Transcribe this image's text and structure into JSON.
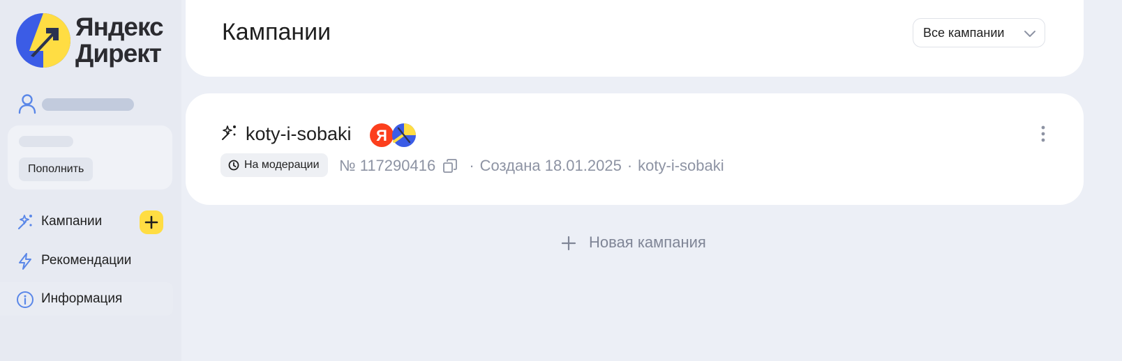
{
  "brand": {
    "line1": "Яндекс",
    "line2": "Директ"
  },
  "sidebar": {
    "topup_label": "Пополнить",
    "nav": [
      {
        "label": "Кампании",
        "icon": "sparkle-wand-icon"
      },
      {
        "label": "Рекомендации",
        "icon": "lightning-icon"
      },
      {
        "label": "Информация",
        "icon": "info-icon"
      }
    ]
  },
  "header": {
    "title": "Кампании",
    "filter_value": "Все кампании"
  },
  "campaign": {
    "name": "koty-i-sobaki",
    "status": "На модерации",
    "number": "№ 117290416",
    "created": "Создана 18.01.2025",
    "domain": "koty-i-sobaki",
    "badges": [
      "Я"
    ]
  },
  "actions": {
    "new_campaign": "Новая кампания"
  },
  "colors": {
    "accent_yellow": "#ffdd43",
    "brand_blue": "#3b5ce6",
    "yandex_red": "#fc3f1d",
    "icon_blue": "#5a87e8"
  }
}
